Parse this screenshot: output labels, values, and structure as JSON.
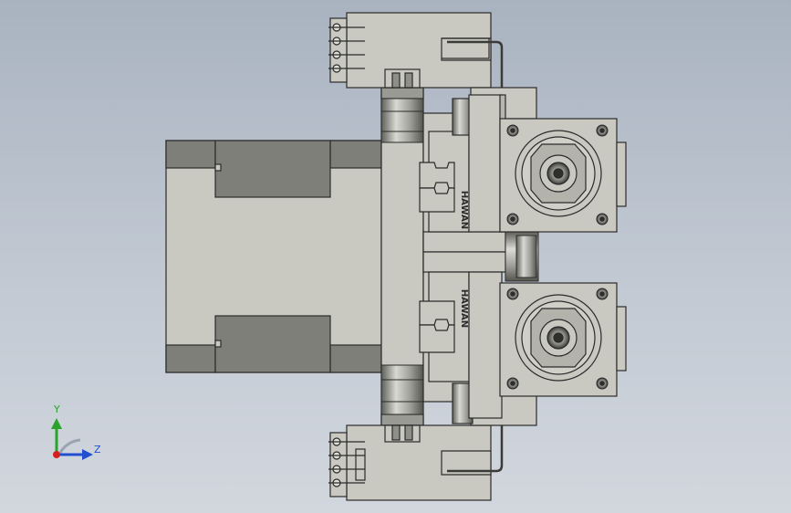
{
  "viewport": {
    "background": "#bcc4ce"
  },
  "part_marking": {
    "upper": "HAWAN",
    "lower": "HAWAN"
  },
  "triad": {
    "y_label": "Y",
    "z_label": "Z",
    "x_color": "#d42020",
    "y_color": "#2aa32a",
    "z_color": "#2050d0"
  },
  "colors": {
    "body": "#c9c9c2",
    "dark": "#7f7f7a",
    "shade": "#9a9a94",
    "outline": "#2b2b2b"
  }
}
